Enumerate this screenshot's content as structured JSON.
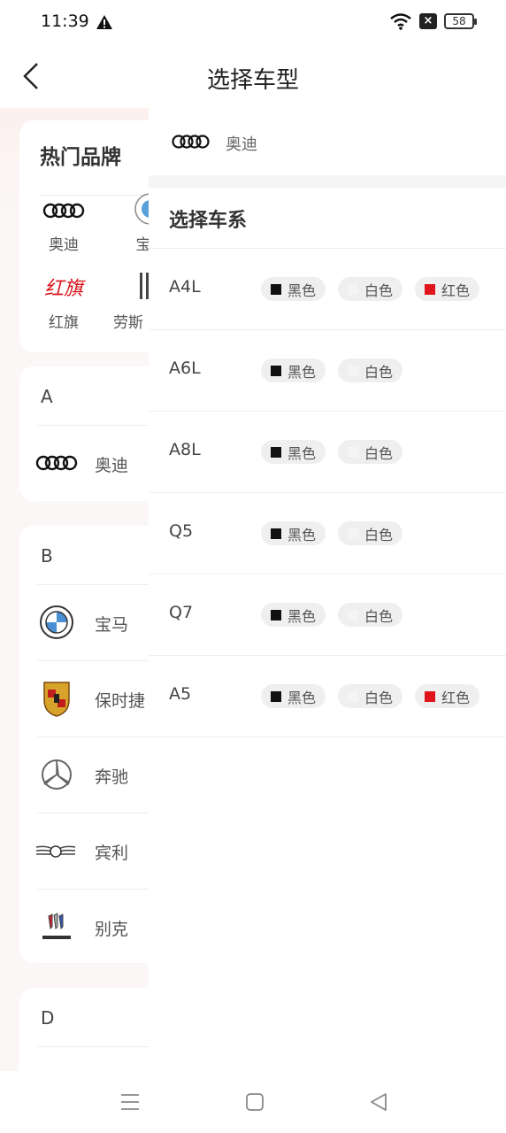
{
  "status_bar": {
    "time": "11:39",
    "battery": "58"
  },
  "header": {
    "title": "选择车型"
  },
  "hot_brands": {
    "title": "热门品牌",
    "items": [
      "奥迪",
      "宝",
      "红旗",
      "劳斯"
    ]
  },
  "sections": [
    {
      "letter": "A",
      "brands": [
        "奥迪"
      ]
    },
    {
      "letter": "B",
      "brands": [
        "宝马",
        "保时捷",
        "奔驰",
        "宾利",
        "别克"
      ]
    },
    {
      "letter": "D",
      "brands": []
    }
  ],
  "drawer": {
    "brand": "奥迪",
    "series_title": "选择车系",
    "series": [
      {
        "name": "A4L",
        "colors": [
          "黑色",
          "白色",
          "红色"
        ]
      },
      {
        "name": "A6L",
        "colors": [
          "黑色",
          "白色"
        ]
      },
      {
        "name": "A8L",
        "colors": [
          "黑色",
          "白色"
        ]
      },
      {
        "name": "Q5",
        "colors": [
          "黑色",
          "白色"
        ]
      },
      {
        "name": "Q7",
        "colors": [
          "黑色",
          "白色"
        ]
      },
      {
        "name": "A5",
        "colors": [
          "黑色",
          "白色",
          "红色"
        ]
      }
    ]
  },
  "colors": {
    "black": "#111111",
    "white": "#f4f4f4",
    "red": "#e0151b",
    "accent_bg": "#fdf0ef"
  }
}
